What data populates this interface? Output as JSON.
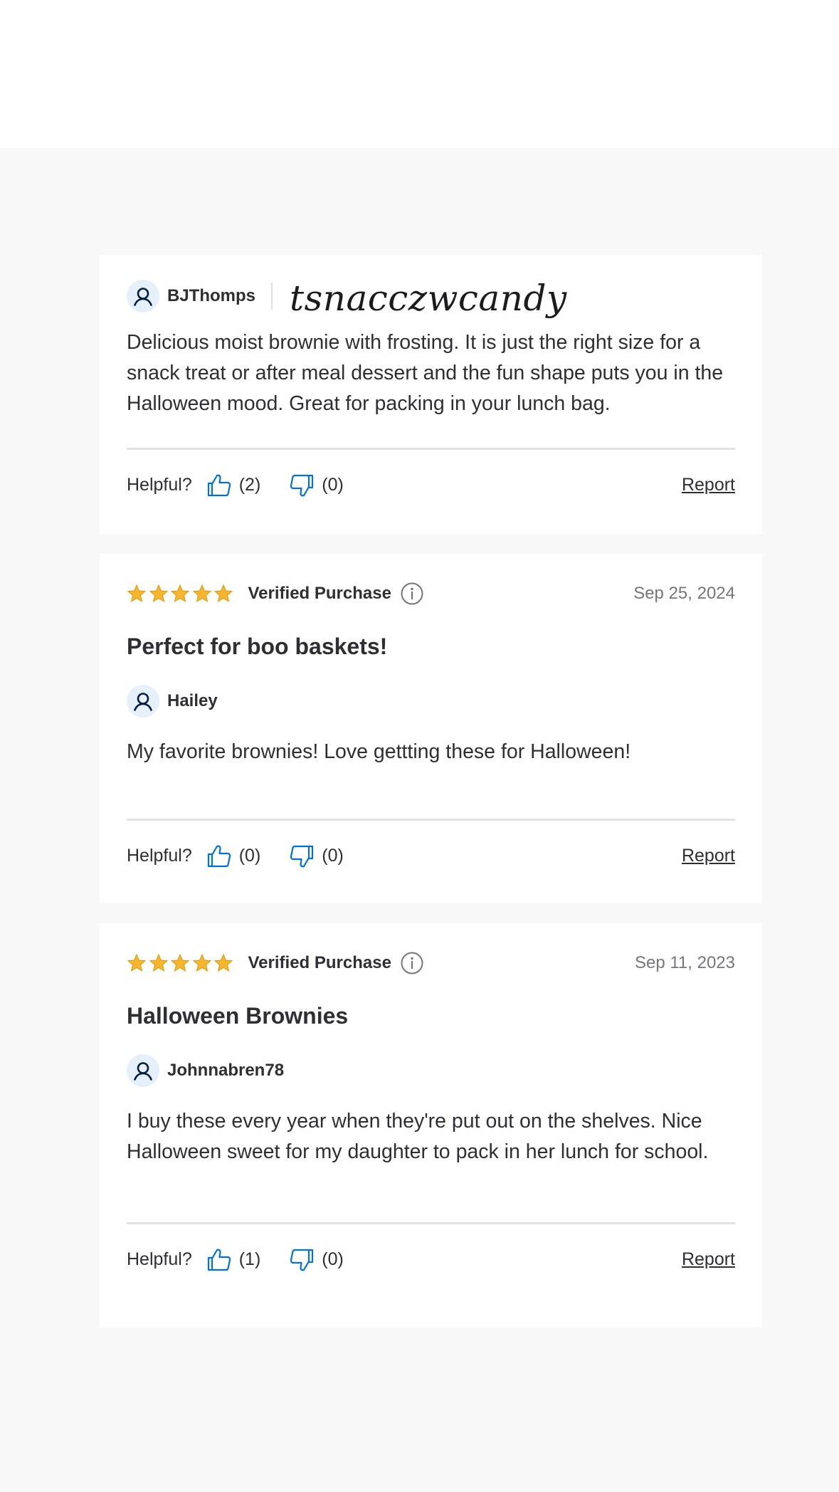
{
  "reviews": [
    {
      "reviewer": "BJThomps",
      "signature": "tsnacczwcandy",
      "body": "Delicious moist brownie with frosting. It is just the right size for a snack treat or after meal dessert and the fun shape puts you in the Halloween mood. Great for packing in your lunch bag.",
      "helpful_label": "Helpful?",
      "up_count": "(2)",
      "down_count": "(0)",
      "report": "Report"
    },
    {
      "rating": 5,
      "verified": "Verified Purchase",
      "date": "Sep 25, 2024",
      "title": "Perfect for boo baskets!",
      "reviewer": "Hailey",
      "body": "My favorite brownies! Love gettting these for Halloween!",
      "helpful_label": "Helpful?",
      "up_count": "(0)",
      "down_count": "(0)",
      "report": "Report"
    },
    {
      "rating": 5,
      "verified": "Verified Purchase",
      "date": "Sep 11, 2023",
      "title": "Halloween Brownies",
      "reviewer": "Johnnabren78",
      "body": "I buy these every year when they're put out on the shelves. Nice Halloween sweet for my daughter to pack in her lunch for school.",
      "helpful_label": "Helpful?",
      "up_count": "(1)",
      "down_count": "(0)",
      "report": "Report"
    }
  ],
  "icons": {
    "avatar": "user-icon",
    "thumbs_up": "thumbs-up-icon",
    "thumbs_down": "thumbs-down-icon",
    "info": "info-icon",
    "star": "star-icon"
  },
  "colors": {
    "star": "#f7b52c",
    "thumb": "#0071dc",
    "avatar_bg": "#e5f0fb",
    "avatar_fg": "#041e42"
  }
}
